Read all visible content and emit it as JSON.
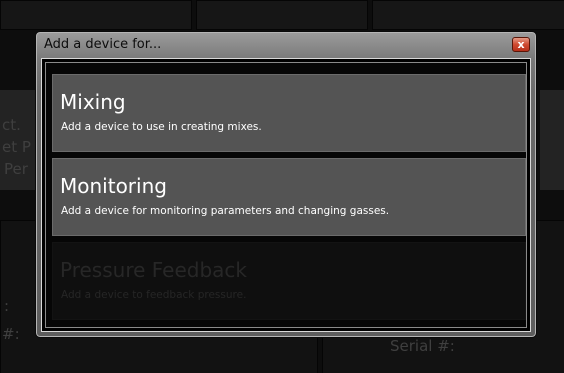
{
  "dialog": {
    "title": "Add a device for...",
    "close_label": "x"
  },
  "options": [
    {
      "title": "Mixing",
      "description": "Add a device to use in creating mixes.",
      "enabled": true
    },
    {
      "title": "Monitoring",
      "description": "Add a device for monitoring parameters and changing gasses.",
      "enabled": true
    },
    {
      "title": "Pressure Feedback",
      "description": "Add a device to feedback pressure.",
      "enabled": false
    }
  ],
  "background": {
    "fragments": [
      "ct.",
      "et P",
      "Per",
      ":",
      "#:",
      "Serial #:"
    ]
  },
  "colors": {
    "close_button": "#cf4a30",
    "tile_enabled": "#545454",
    "tile_disabled": "#0f0f0f"
  }
}
